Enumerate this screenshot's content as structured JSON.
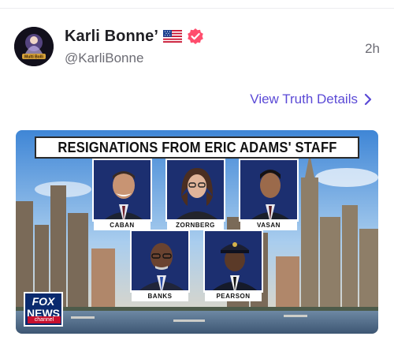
{
  "post": {
    "author_name": "Karli Bonne’",
    "author_handle": "@KarliBonne",
    "time": "2h",
    "details_link": "View Truth Details",
    "avatar_text": "Multi Bolli"
  },
  "media": {
    "headline": "RESIGNATIONS FROM ERIC ADAMS' STAFF",
    "people": [
      "CABAN",
      "ZORNBERG",
      "VASAN",
      "BANKS",
      "PEARSON"
    ],
    "logo": {
      "line1": "FOX",
      "line2": "NEWS",
      "line3": "channel"
    }
  },
  "colors": {
    "accent": "#5b4ad6",
    "verified": "#ff4d6d",
    "text_primary": "#1f1f24",
    "text_secondary": "#6c6c74"
  },
  "icons": [
    "us-flag-icon",
    "verified-badge-icon",
    "chevron-right-icon",
    "fox-news-logo"
  ]
}
